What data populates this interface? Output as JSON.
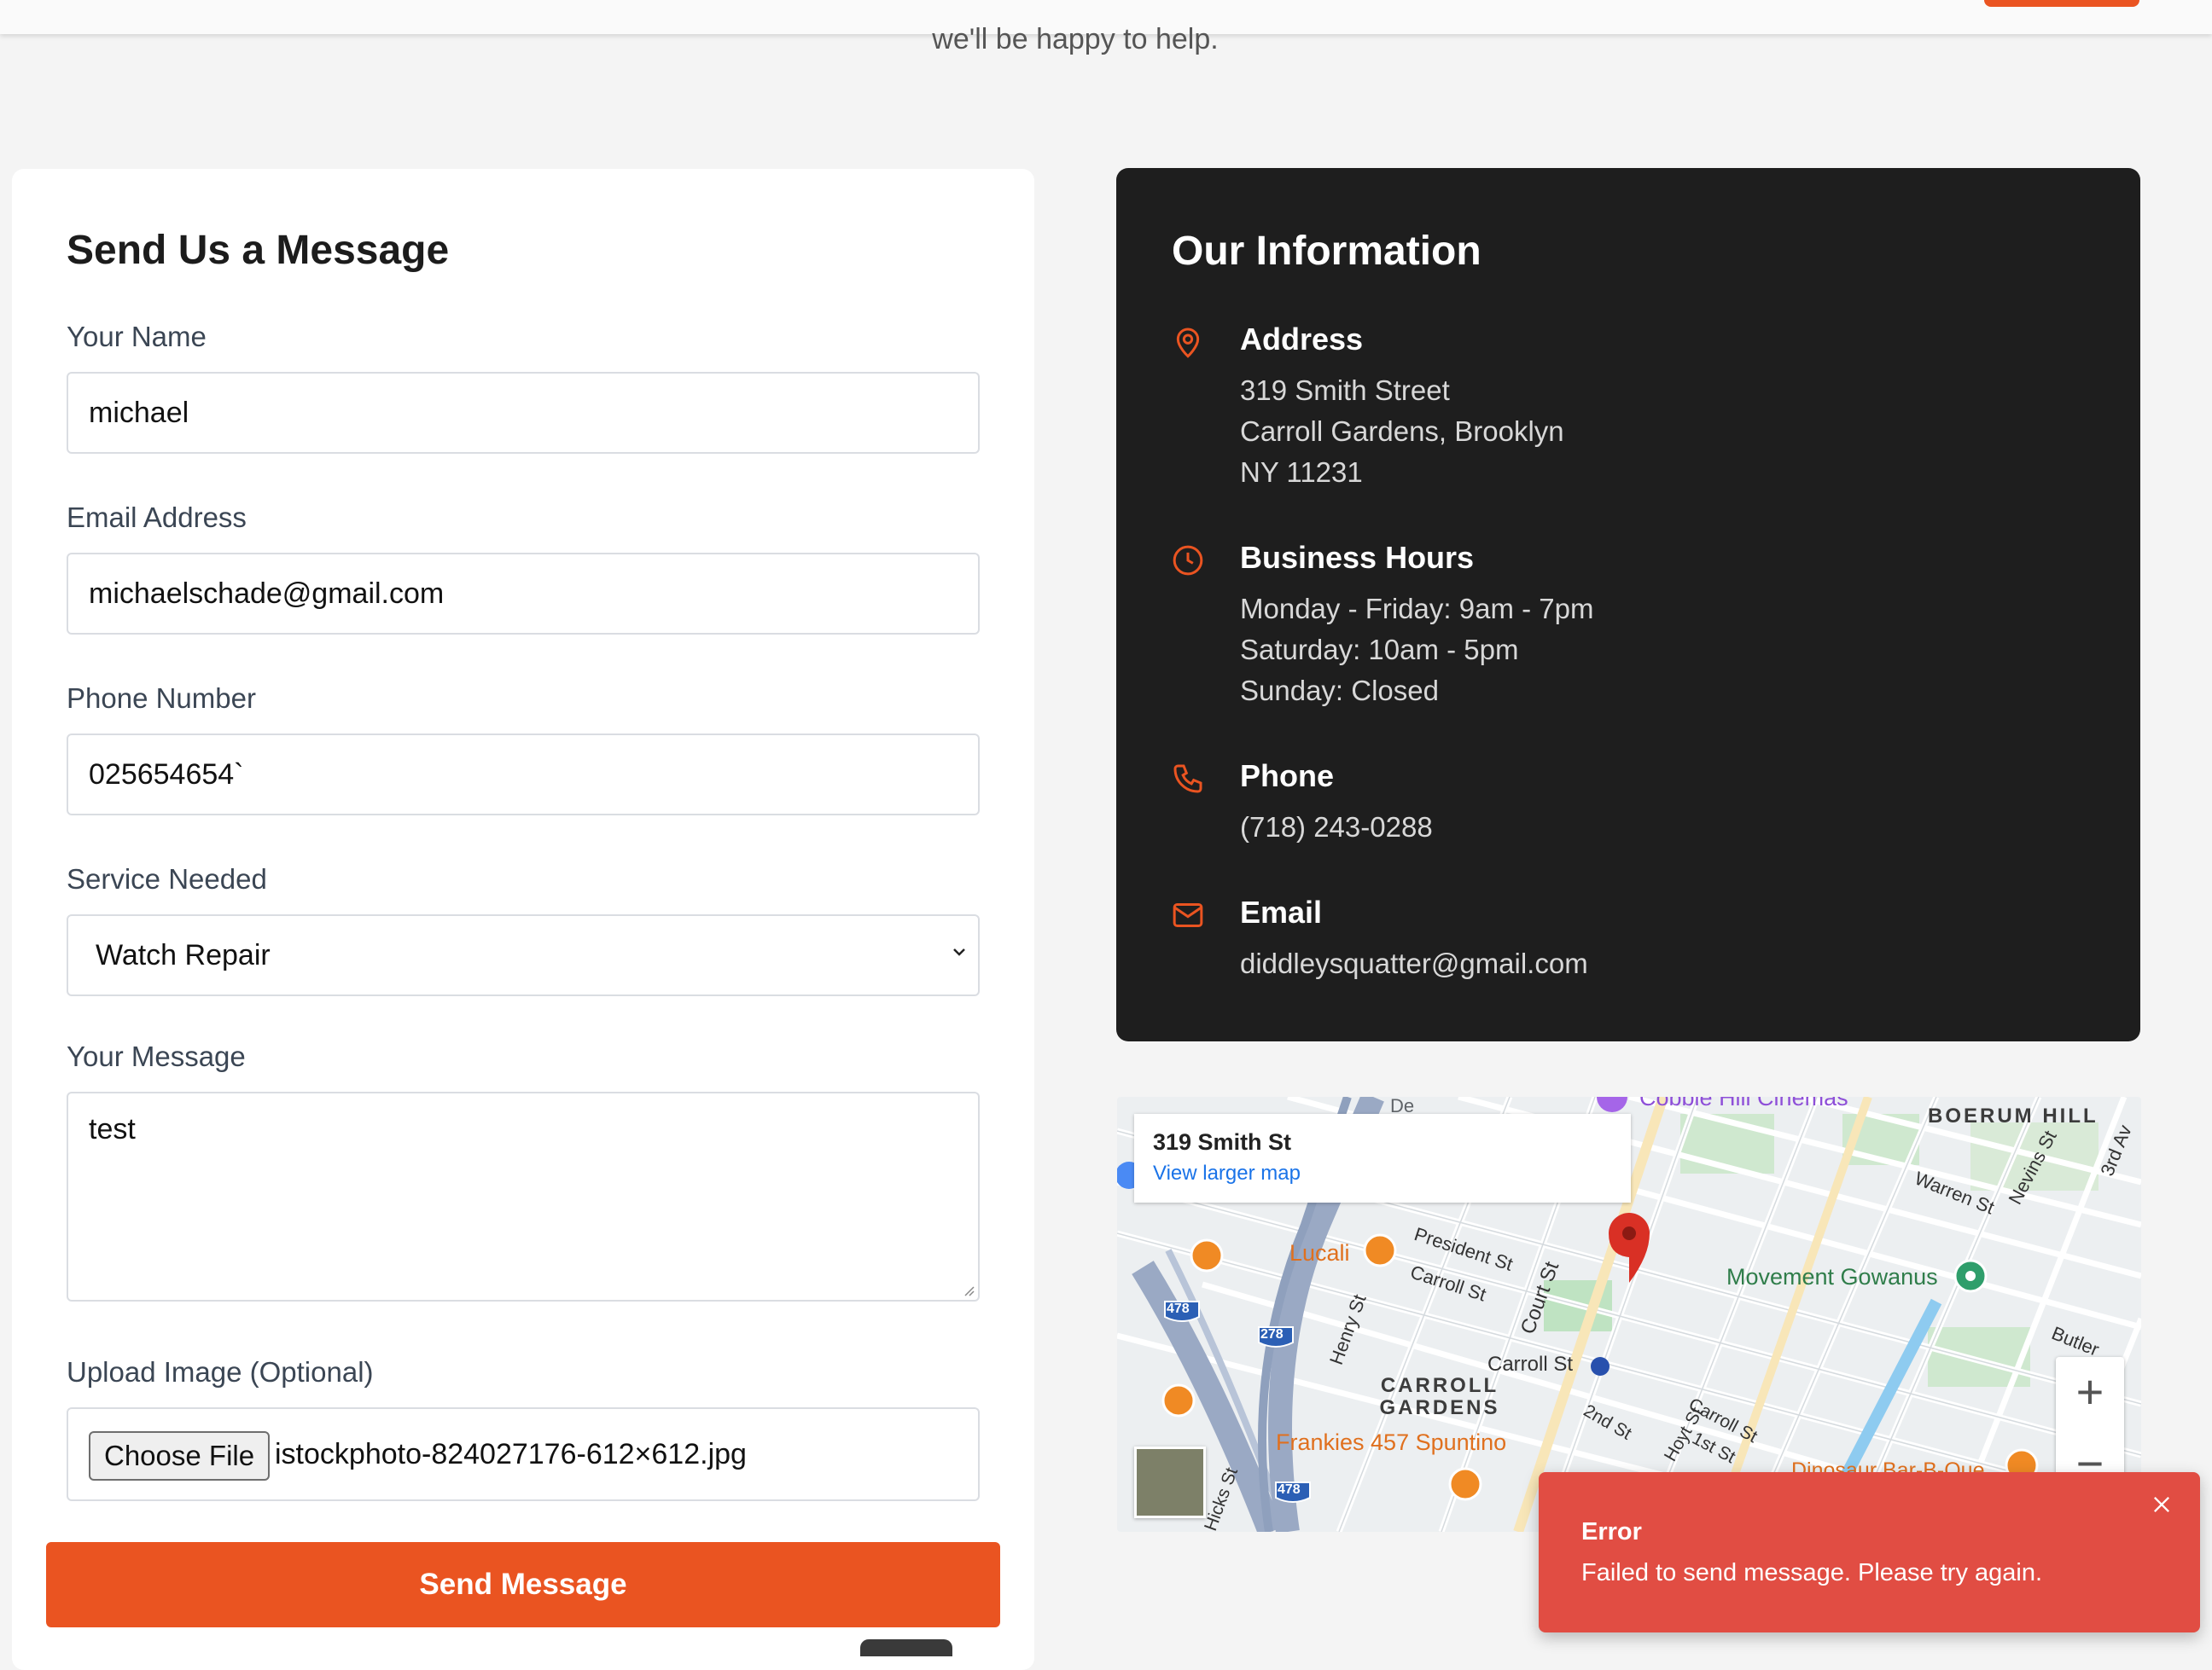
{
  "header": {
    "subtitle": "we'll be happy to help."
  },
  "form": {
    "title": "Send Us a Message",
    "fields": {
      "name": {
        "label": "Your Name",
        "value": "michael"
      },
      "email": {
        "label": "Email Address",
        "value": "michaelschade@gmail.com"
      },
      "phone": {
        "label": "Phone Number",
        "value": "025654654`"
      },
      "service": {
        "label": "Service Needed",
        "value": "Watch Repair"
      },
      "message": {
        "label": "Your Message",
        "value": "test"
      },
      "upload": {
        "label": "Upload Image (Optional)",
        "button": "Choose File",
        "file": "istockphoto-824027176-612×612.jpg"
      }
    },
    "submit_label": "Send Message"
  },
  "info": {
    "title": "Our Information",
    "address": {
      "heading": "Address",
      "lines": [
        "319 Smith Street",
        "Carroll Gardens, Brooklyn",
        "NY 11231"
      ]
    },
    "hours": {
      "heading": "Business Hours",
      "lines": [
        "Monday - Friday: 9am - 7pm",
        "Saturday: 10am - 5pm",
        "Sunday: Closed"
      ]
    },
    "phone": {
      "heading": "Phone",
      "value": "(718) 243-0288"
    },
    "email": {
      "heading": "Email",
      "value": "diddleysquatter@gmail.com"
    }
  },
  "map": {
    "place": "319 Smith St",
    "link": "View larger map",
    "labels": {
      "cinemas": "Cobble Hill Cinemas",
      "boerum": "BOERUM HILL",
      "warren": "Warren St",
      "nevins": "Nevins St",
      "third_ave": "3rd Av",
      "lucali": "Lucali",
      "president": "President St",
      "carroll1": "Carroll St",
      "court": "Court St",
      "henry": "Henry St",
      "movement": "Movement Gowanus",
      "butler": "Butler",
      "carroll_station": "Carroll St",
      "carroll_gardens": "CARROLL GARDENS",
      "second": "2nd St",
      "hoyt": "Hoyt St",
      "carroll2": "Carroll St",
      "first": "1st St",
      "frankies": "Frankies 457 Spuntino",
      "hicks": "Hicks St",
      "dinosaur": "Dinosaur Bar-B-Que",
      "de": "De",
      "hwy478a": "478",
      "hwy278": "278",
      "hwy478b": "478"
    },
    "zoom_in": "+",
    "zoom_out": "−"
  },
  "toast": {
    "title": "Error",
    "message": "Failed to send message. Please try again."
  },
  "colors": {
    "accent": "#ea5421",
    "dark_card": "#1e1e1e",
    "toast": "#e14d43",
    "link": "#1a73e8"
  },
  "icons": [
    "map-pin-icon",
    "clock-icon",
    "phone-icon",
    "mail-icon",
    "chevron-down-icon",
    "close-icon",
    "map-marker-icon",
    "restaurant-icon",
    "subway-icon"
  ]
}
